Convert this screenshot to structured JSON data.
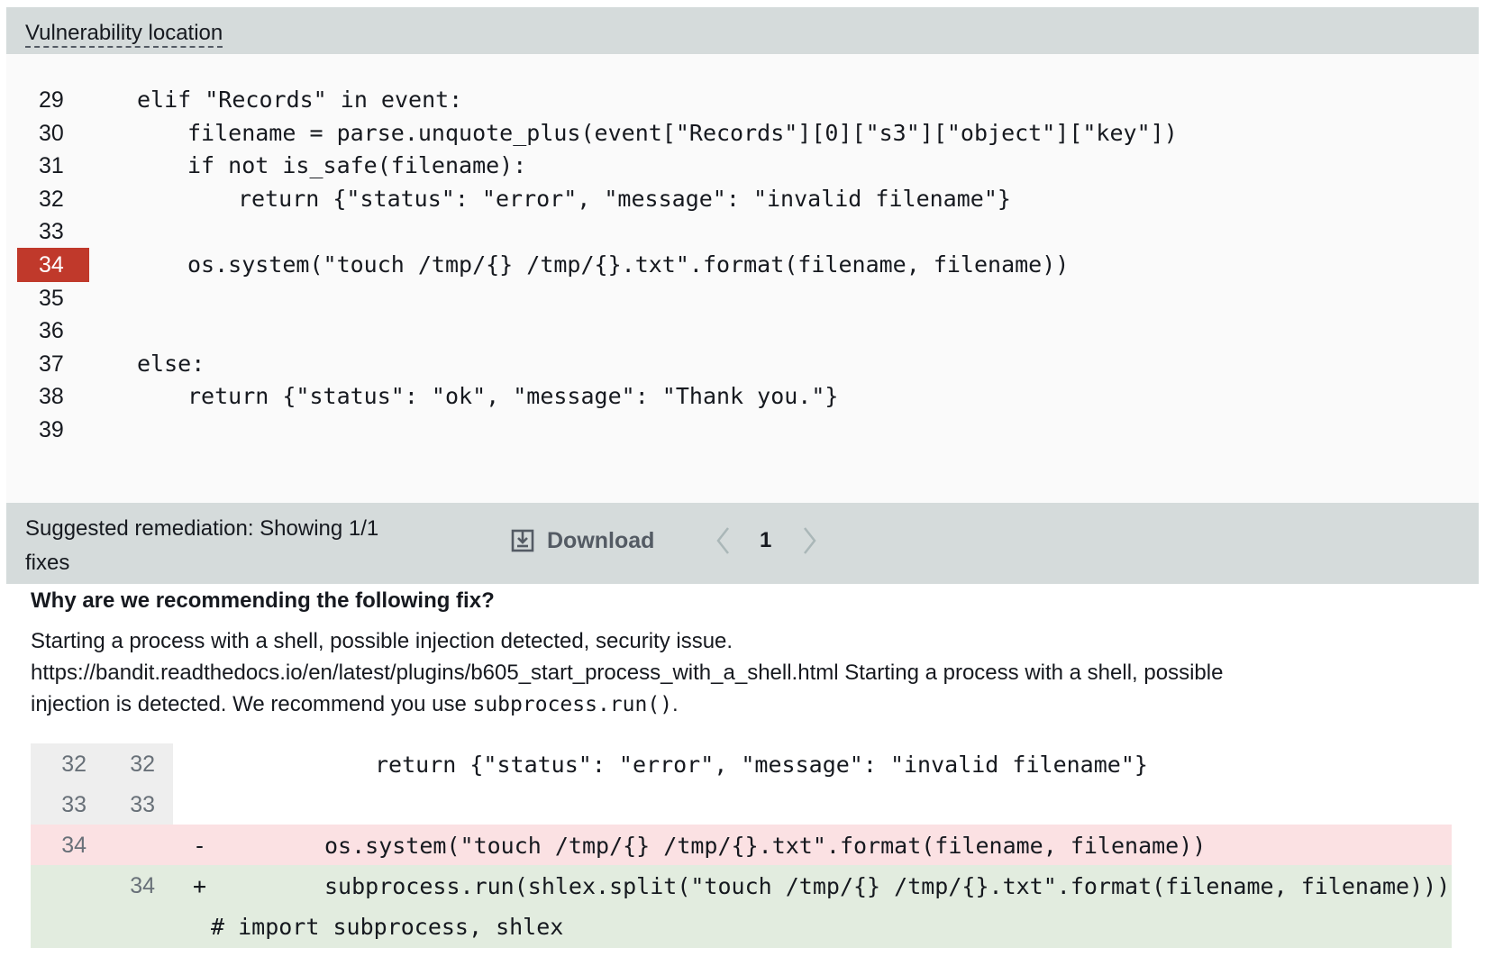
{
  "vulnerability": {
    "title": "Vulnerability location",
    "highlighted_line": "34",
    "lines": [
      {
        "num": "29",
        "code": "elif \"Records\" in event:",
        "indent": 0
      },
      {
        "num": "30",
        "code": "filename = parse.unquote_plus(event[\"Records\"][0][\"s3\"][\"object\"][\"key\"])",
        "indent": 1
      },
      {
        "num": "31",
        "code": "if not is_safe(filename):",
        "indent": 1
      },
      {
        "num": "32",
        "code": "return {\"status\": \"error\", \"message\": \"invalid filename\"}",
        "indent": 2
      },
      {
        "num": "33",
        "code": "",
        "indent": 0
      },
      {
        "num": "34",
        "code": "os.system(\"touch /tmp/{} /tmp/{}.txt\".format(filename, filename))",
        "indent": 1
      },
      {
        "num": "35",
        "code": "",
        "indent": 0
      },
      {
        "num": "36",
        "code": "",
        "indent": 0
      },
      {
        "num": "37",
        "code": "else:",
        "indent": 0
      },
      {
        "num": "38",
        "code": "return {\"status\": \"ok\", \"message\": \"Thank you.\"}",
        "indent": 1
      },
      {
        "num": "39",
        "code": "",
        "indent": 0
      }
    ]
  },
  "remediation": {
    "title": "Suggested remediation: Showing 1/1 fixes",
    "download_label": "Download",
    "page": "1",
    "why_heading": "Why are we recommending the following fix?",
    "why_text": "Starting a process with a shell, possible injection detected, security issue. https://bandit.readthedocs.io/en/latest/plugins/b605_start_process_with_a_shell.html Starting a process with a shell, possible injection is detected. We recommend you use ",
    "why_code": "subprocess.run()",
    "why_suffix": "."
  },
  "diff": [
    {
      "old": "32",
      "new": "32",
      "sign": "",
      "type": "context",
      "code": "return {\"status\": \"error\", \"message\": \"invalid filename\"}"
    },
    {
      "old": "33",
      "new": "33",
      "sign": "",
      "type": "context",
      "code": ""
    },
    {
      "old": "34",
      "new": "",
      "sign": "-",
      "type": "removed",
      "code": "os.system(\"touch /tmp/{} /tmp/{}.txt\".format(filename, filename))"
    },
    {
      "old": "",
      "new": "34",
      "sign": "+",
      "type": "added",
      "code": "subprocess.run(shlex.split(\"touch /tmp/{} /tmp/{}.txt\".format(filename, filename)))"
    },
    {
      "old": "",
      "new": "",
      "sign": "",
      "type": "added",
      "code": "# import subprocess, shlex"
    }
  ],
  "colors": {
    "highlight": "#c0392b",
    "removed_bg": "#fbe1e3",
    "added_bg": "#e2ecdf",
    "header_bg": "#d5dbdb"
  },
  "icons": {
    "download": "download-icon",
    "prev": "chevron-left-icon",
    "next": "chevron-right-icon"
  }
}
